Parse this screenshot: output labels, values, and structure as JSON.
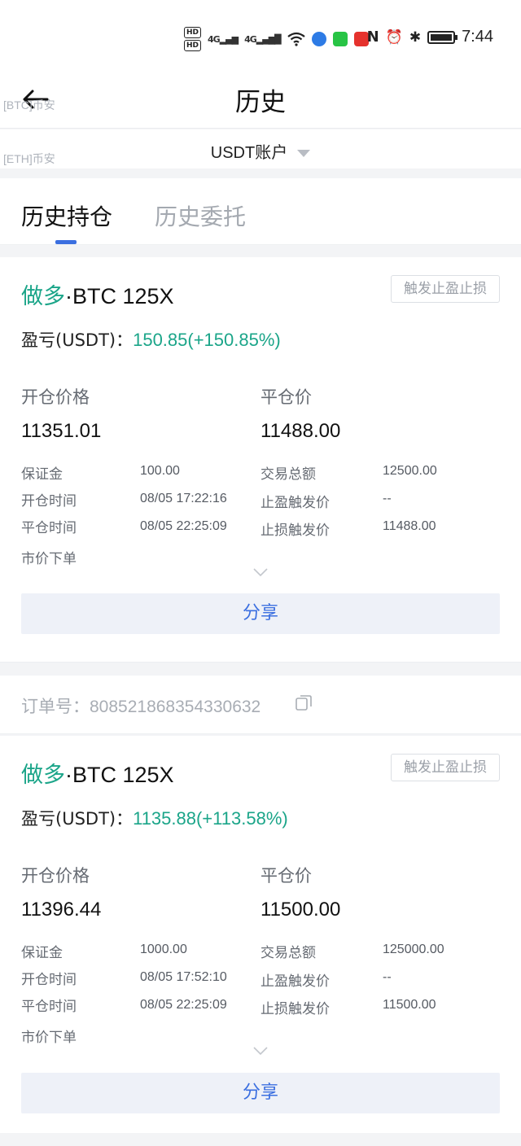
{
  "status_bar": {
    "hd1": "HD",
    "hd2": "HD",
    "sig1": "4G",
    "sig2": "4G",
    "nfc": "N",
    "alarm": "⏰",
    "bluetooth": "✱",
    "time": "7:44"
  },
  "header": {
    "title": "历史",
    "watermarks": [
      "[BTC]币安",
      "[ETH]币安"
    ]
  },
  "account": {
    "label": "USDT账户"
  },
  "tabs": [
    {
      "label": "历史持仓",
      "active": true
    },
    {
      "label": "历史委托",
      "active": false
    }
  ],
  "labels": {
    "trigger": "触发止盈止损",
    "pnl": "盈亏(USDT)：",
    "open_price": "开仓价格",
    "close_price": "平仓价",
    "margin": "保证金",
    "trade_total": "交易总额",
    "open_time": "开仓时间",
    "tp_trigger": "止盈触发价",
    "close_time": "平仓时间",
    "sl_trigger": "止损触发价",
    "order_type": "市价下单",
    "share": "分享",
    "order_no": "订单号："
  },
  "positions": [
    {
      "direction": "做多",
      "symbol": "·BTC 125X",
      "pnl": "150.85(+150.85%)",
      "open_price": "11351.01",
      "close_price": "11488.00",
      "margin": "100.00",
      "trade_total": "12500.00",
      "open_time": "08/05 17:22:16",
      "tp_trigger": "--",
      "close_time": "08/05 22:25:09",
      "sl_trigger": "11488.00"
    },
    {
      "direction": "做多",
      "symbol": "·BTC 125X",
      "pnl": "1135.88(+113.58%)",
      "open_price": "11396.44",
      "close_price": "11500.00",
      "margin": "1000.00",
      "trade_total": "125000.00",
      "open_time": "08/05 17:52:10",
      "tp_trigger": "--",
      "close_time": "08/05 22:25:09",
      "sl_trigger": "11500.00"
    }
  ],
  "order_number": "808521868354330632",
  "colors": {
    "profit_green": "#1ba589",
    "accent_blue": "#3b6fe0",
    "muted_gray": "#a4a9b0"
  }
}
